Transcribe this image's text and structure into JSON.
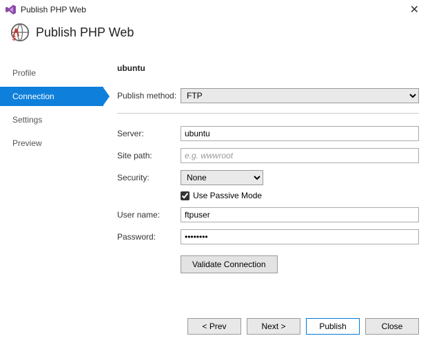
{
  "window": {
    "title": "Publish PHP Web"
  },
  "header": {
    "title": "Publish PHP Web"
  },
  "sidebar": {
    "items": [
      {
        "label": "Profile"
      },
      {
        "label": "Connection"
      },
      {
        "label": "Settings"
      },
      {
        "label": "Preview"
      }
    ]
  },
  "main": {
    "section_title": "ubuntu",
    "publish_method_label": "Publish method:",
    "publish_method_value": "FTP",
    "server_label": "Server:",
    "server_value": "ubuntu",
    "sitepath_label": "Site path:",
    "sitepath_placeholder": "e.g. wwwroot",
    "security_label": "Security:",
    "security_value": "None",
    "passive_label": "Use Passive Mode",
    "username_label": "User name:",
    "username_value": "ftpuser",
    "password_label": "Password:",
    "password_value": "••••••••",
    "validate_label": "Validate Connection"
  },
  "footer": {
    "prev": "< Prev",
    "next": "Next >",
    "publish": "Publish",
    "close": "Close"
  }
}
